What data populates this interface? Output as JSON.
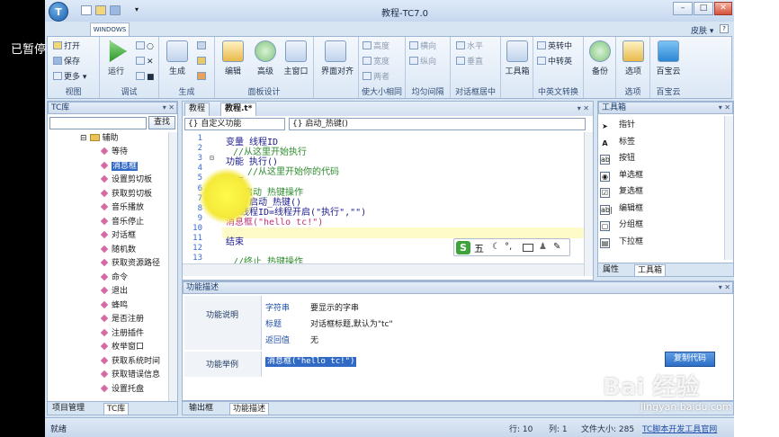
{
  "overlay": {
    "paused": "已暂停"
  },
  "window": {
    "title": "教程-TC7.0",
    "skin_label": "皮肤 ▾"
  },
  "ribbon": {
    "tab": "WINDOWS",
    "groups": {
      "view": {
        "name": "视图",
        "open": "打开",
        "save": "保存",
        "more": "更多"
      },
      "debug": {
        "name": "调试",
        "run": "运行"
      },
      "build": {
        "name": "生成",
        "build": "生成"
      },
      "panel": {
        "name": "面板设计",
        "edit": "编辑",
        "advanced": "高级",
        "main_window": "主窗口"
      },
      "align": {
        "name": "",
        "label": "界面对齐"
      },
      "size": {
        "name": "使大小相同",
        "height": "高度",
        "width": "宽度",
        "both": "两者"
      },
      "spacing": {
        "name": "均匀间隔",
        "horizontal": "横向",
        "vertical": "纵向"
      },
      "center": {
        "name": "对话框居中",
        "horizontal": "水平",
        "vertical": "垂直"
      },
      "tools": {
        "name": "",
        "label": "工具箱"
      },
      "convert": {
        "name": "中英文转换",
        "to_en": "英转中",
        "to_cn": "中转英"
      },
      "backup": {
        "name": "",
        "label": "备份"
      },
      "options": {
        "name": "选项",
        "label": "选项"
      },
      "cloud": {
        "name": "百宝云",
        "label": "百宝云"
      }
    }
  },
  "tclib": {
    "title": "TC库",
    "search_button": "查找",
    "root": "辅助",
    "items": [
      "等待",
      "消息框",
      "设置剪切板",
      "获取剪切板",
      "音乐播放",
      "音乐停止",
      "对话框",
      "随机数",
      "获取资源路径",
      "命令",
      "退出",
      "蜂鸣",
      "是否注册",
      "注册插件",
      "枚举窗口",
      "获取系统时间",
      "获取错误信息",
      "设置托盘"
    ],
    "selected": "消息框",
    "tabs": [
      "项目管理",
      "TC库"
    ]
  },
  "editor": {
    "tabs": [
      "教程",
      "教程.t*"
    ],
    "combo_left": "{} 自定义功能",
    "combo_right": "{} 启动_热键()",
    "lines": [
      {
        "n": "1",
        "text": "变量 线程ID"
      },
      {
        "n": "2",
        "text": "//从这里开始执行"
      },
      {
        "n": "3",
        "text": "功能 执行()"
      },
      {
        "n": "4",
        "text": "//从这里开始你的代码"
      },
      {
        "n": "5",
        "text": "结束"
      },
      {
        "n": "6",
        "text": "//启动_热键操作"
      },
      {
        "n": "7",
        "text": "功能 启动_热键()"
      },
      {
        "n": "8",
        "text": "线程ID=线程开启(\"执行\",\"\")"
      },
      {
        "n": "9",
        "text": "消息框(\"hello tc!\")"
      },
      {
        "n": "10",
        "text": ""
      },
      {
        "n": "11",
        "text": "结束"
      },
      {
        "n": "12",
        "text": ""
      },
      {
        "n": "13",
        "text": "//终止_热键操作"
      }
    ]
  },
  "ime": {
    "logo": "S",
    "mode": "五"
  },
  "toolbox": {
    "title": "工具箱",
    "items": [
      "指针",
      "标签",
      "按钮",
      "单选框",
      "复选框",
      "编辑框",
      "分组框",
      "下拉框"
    ],
    "tabs": [
      "属性",
      "工具箱"
    ]
  },
  "description": {
    "title": "功能描述",
    "label_explain": "功能说明",
    "params": [
      {
        "name": "字符串",
        "desc": "要显示的字串"
      },
      {
        "name": "标题",
        "desc": "对话框标题,默认为\"tc\""
      },
      {
        "name": "返回值",
        "desc": "无"
      }
    ],
    "label_example": "功能举例",
    "example": "消息框(\"hello tc!\")",
    "copy_button": "复制代码",
    "tabs": [
      "输出框",
      "功能描述"
    ]
  },
  "status": {
    "text": "就绪",
    "line": "行: 10",
    "col": "列: 1",
    "filesize": "文件大小: 285",
    "link": "TC脚本开发工具官网"
  },
  "watermark": {
    "brand": "Bai 经验",
    "url": "jingyan.baidu.com"
  }
}
